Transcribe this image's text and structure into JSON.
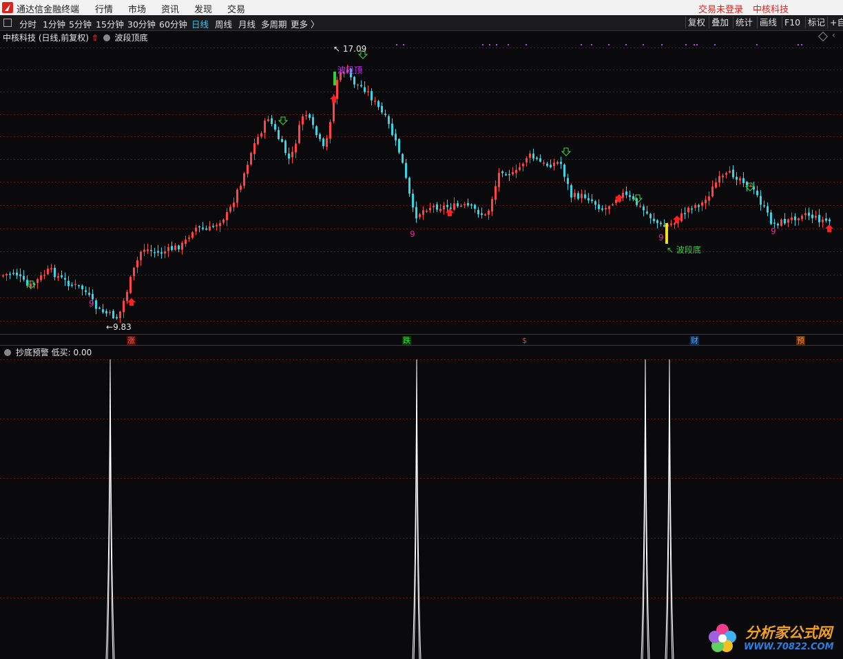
{
  "menubar": {
    "app_title": "通达信金融终端",
    "menus": [
      "行情",
      "市场",
      "资讯",
      "发现",
      "交易"
    ],
    "right_items": [
      "交易未登录",
      "中核科技"
    ]
  },
  "toolbar": {
    "periods": [
      "分时",
      "1分钟",
      "5分钟",
      "15分钟",
      "30分钟",
      "60分钟",
      "日线",
      "周线",
      "月线",
      "多周期",
      "更多 〉"
    ],
    "active_period": "日线",
    "right_buttons": [
      "复权",
      "叠加",
      "统计",
      "画线",
      "F10",
      "标记",
      "+自"
    ]
  },
  "chart": {
    "stock_title": "中核科技 (日线,前复权)",
    "indicator_name": "波段顶底",
    "high_label": "17.09",
    "low_label": "9.83",
    "top_text": "波段顶",
    "bottom_text": "↖ 波段底",
    "nine_label": "9",
    "event_tags": [
      {
        "text": "涨",
        "color": "#ff5a5a"
      },
      {
        "text": "跌",
        "color": "#40e040"
      },
      {
        "text": "$",
        "color": "#ff3030"
      },
      {
        "text": "财",
        "color": "#4aa8ff"
      },
      {
        "text": "预",
        "color": "#ff8c2a"
      }
    ],
    "colors": {
      "up": "#ff4444",
      "down": "#36d6e7",
      "signal_down": "#3adf3a",
      "signal_up": "#ff2020",
      "nine": "#e0309a"
    }
  },
  "indicator": {
    "header": "抄底预警",
    "value_label": "低买: 0.00"
  },
  "watermark": {
    "line1": "分析家公式网",
    "line2": "WWW.70822.COM"
  }
}
